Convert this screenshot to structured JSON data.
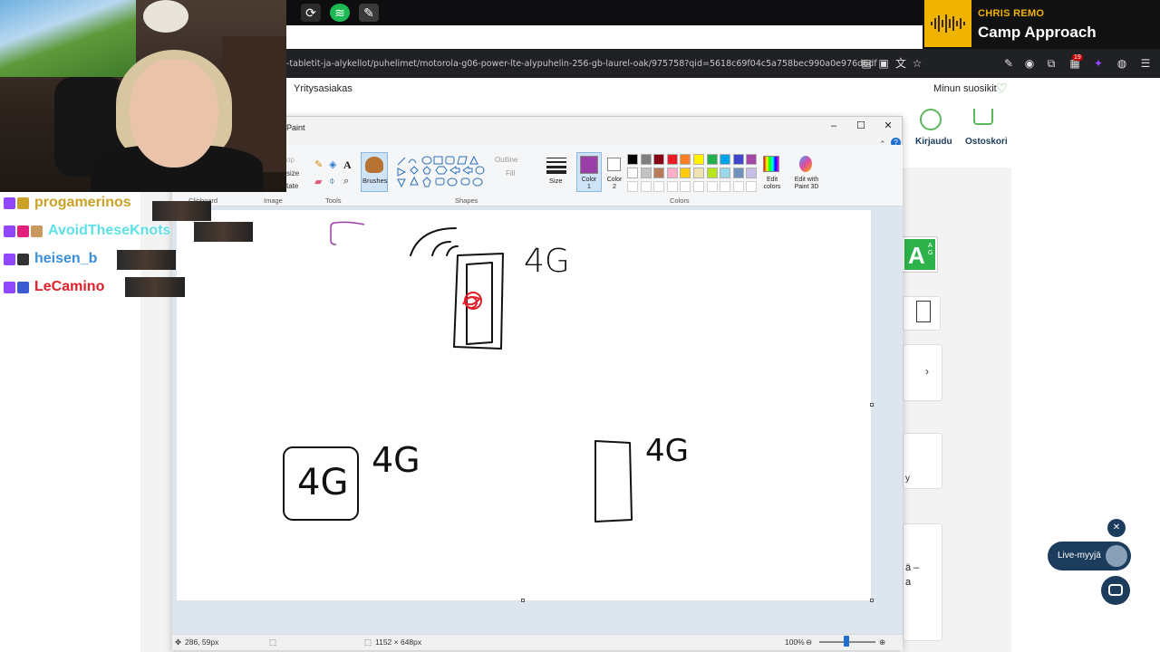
{
  "now_playing": {
    "artist": "CHRIS REMO",
    "title": "Camp Approach"
  },
  "browser": {
    "url": "-tabletit-ja-alykellot/puhelimet/motorola-g06-power-lte-alypuhelin-256-gb-laurel-oak/975758?qid=5618c69f04c5a758bec990a0e976d6df",
    "notification_count": "19"
  },
  "site": {
    "business_link": "Yritysasiakas",
    "favorites_label": "Minun suosikit",
    "login_label": "Kirjaudu",
    "cart_label": "Ostoskori",
    "energy_badge": "A",
    "energy_scale": "A G",
    "card_text_1": "ä –",
    "card_text_2": "a",
    "card_text_3": "y",
    "live_seller_label": "Live-myyjä"
  },
  "chat": [
    {
      "name": "progamerinos",
      "color": "#c9a227"
    },
    {
      "name": "AvoidTheseKnots",
      "color": "#5ee0e8"
    },
    {
      "name": "heisen_b",
      "color": "#3b8fd8"
    },
    {
      "name": "LeCamino",
      "color": "#e0202a"
    }
  ],
  "paint": {
    "title": "Paint",
    "groups": {
      "clipboard": "Clipboard",
      "image": "Image",
      "tools": "Tools",
      "brushes": "Brushes",
      "shapes": "Shapes",
      "size": "Size",
      "colors": "Colors"
    },
    "image_items": [
      "op",
      "size",
      "tate"
    ],
    "outline_label": "Outline",
    "fill_label": "Fill",
    "color1_label": "Color 1",
    "color2_label": "Color 2",
    "color1_value": "#9b3fa8",
    "edit_colors_label": "Edit colors",
    "edit_3d_label": "Edit with Paint 3D",
    "palette": [
      "#000000",
      "#7f7f7f",
      "#880015",
      "#ed1c24",
      "#ff7f27",
      "#fff200",
      "#22b14c",
      "#00a2e8",
      "#3f48cc",
      "#a349a4",
      "#ffffff",
      "#c3c3c3",
      "#b97a57",
      "#ffaec9",
      "#ffc90e",
      "#efe4b0",
      "#b5e61d",
      "#99d9ea",
      "#7092be",
      "#c8bfe7"
    ],
    "canvas_text": {
      "t1": "4G",
      "t2": "4G",
      "t3": "4G",
      "t4": "4G"
    },
    "status": {
      "cursor": "286, 59px",
      "dimensions": "1152 × 648px",
      "zoom": "100%"
    }
  }
}
